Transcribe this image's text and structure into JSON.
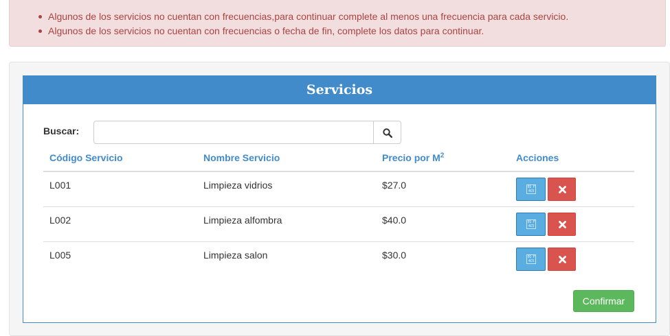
{
  "alerts": [
    "Algunos de los servicios no cuentan con frecuencias,para continuar complete al menos una frecuencia para cada servicio.",
    "Algunos de los servicios no cuentan con frecuencias o fecha de fin, complete los datos para continuar."
  ],
  "panel": {
    "title": "Servicios"
  },
  "search": {
    "label": "Buscar:",
    "value": "",
    "placeholder": ""
  },
  "table": {
    "headers": {
      "code": "Código Servicio",
      "name": "Nombre Servicio",
      "price": "Precio por M",
      "price_sup": "2",
      "actions": "Acciones"
    },
    "rows": [
      {
        "code": "L001",
        "name": "Limpieza vidrios",
        "price": "$27.0"
      },
      {
        "code": "L002",
        "name": "Limpieza alfombra",
        "price": "$40.0"
      },
      {
        "code": "L005",
        "name": "Limpieza salon",
        "price": "$30.0"
      }
    ]
  },
  "icons": {
    "search": "search-icon",
    "edit": "calendar-edit-icon",
    "delete": "close-icon"
  },
  "edit_icon_glyph": "01 F\n4C5",
  "buttons": {
    "confirm": "Confirmar"
  },
  "colors": {
    "alert_text": "#a94442",
    "panel_primary": "#428bca",
    "edit": "#5aade0",
    "delete": "#d9534f",
    "confirm": "#5cb85c"
  }
}
